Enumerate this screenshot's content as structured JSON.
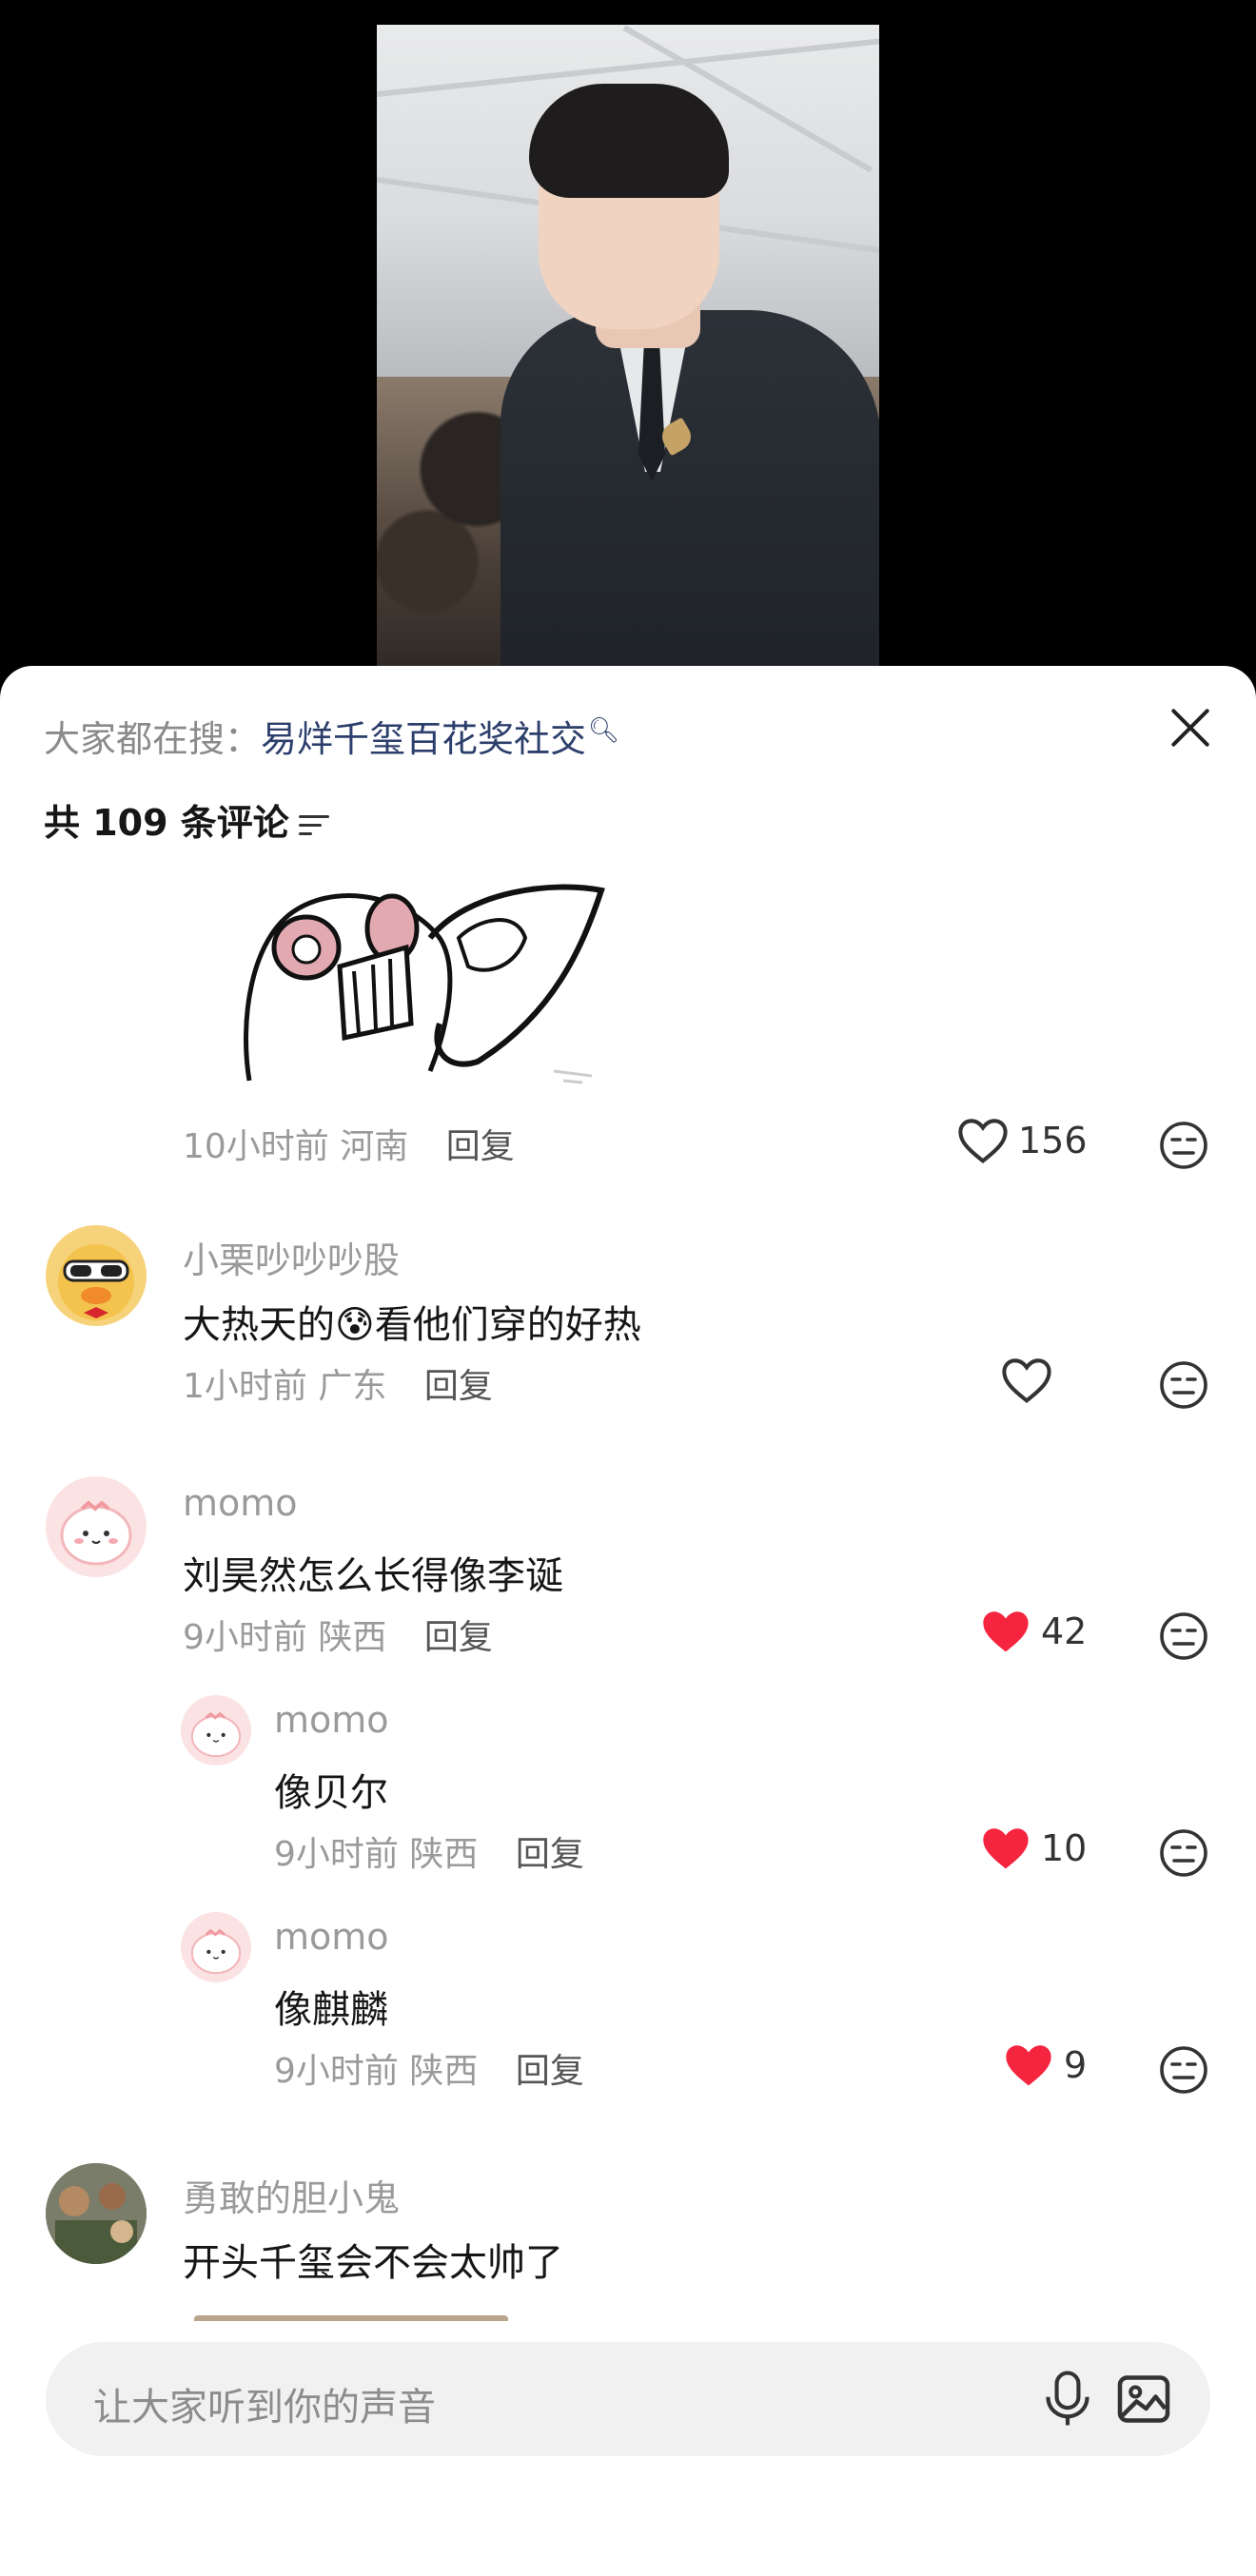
{
  "trending": {
    "prefix": "大家都在搜：",
    "term": "易烊千玺百花奖社交",
    "search_icon": "search-icon"
  },
  "header": {
    "comment_count_label": "共 109 条评论",
    "filter_icon": "filter-icon",
    "close_icon": "close-icon"
  },
  "comments": [
    {
      "meta_time": "10小时前",
      "meta_location": "河南",
      "reply_label": "回复",
      "likes": "156",
      "liked": false,
      "has_sticker": true
    },
    {
      "author": "小栗吵吵吵股",
      "text_before_emoji": "大热天的",
      "emoji": "😰",
      "text_after_emoji": "看他们穿的好热",
      "meta_time": "1小时前",
      "meta_location": "广东",
      "reply_label": "回复",
      "likes": "",
      "liked": false
    },
    {
      "author": "momo",
      "text": "刘昊然怎么长得像李诞",
      "meta_time": "9小时前",
      "meta_location": "陕西",
      "reply_label": "回复",
      "likes": "42",
      "liked": true,
      "replies": [
        {
          "author": "momo",
          "text": "像贝尔",
          "meta_time": "9小时前",
          "meta_location": "陕西",
          "reply_label": "回复",
          "likes": "10",
          "liked": true
        },
        {
          "author": "momo",
          "text": "像麒麟",
          "meta_time": "9小时前",
          "meta_location": "陕西",
          "reply_label": "回复",
          "likes": "9",
          "liked": true
        }
      ]
    },
    {
      "author": "勇敢的胆小鬼",
      "text": "开头千玺会不会太帅了"
    }
  ],
  "input": {
    "placeholder": "让大家听到你的声音",
    "mic_icon": "microphone-icon",
    "image_icon": "image-icon"
  },
  "colors": {
    "liked_heart": "#f5243f",
    "link_blue": "#2c3e6b",
    "muted_text": "#9a9a9a"
  }
}
